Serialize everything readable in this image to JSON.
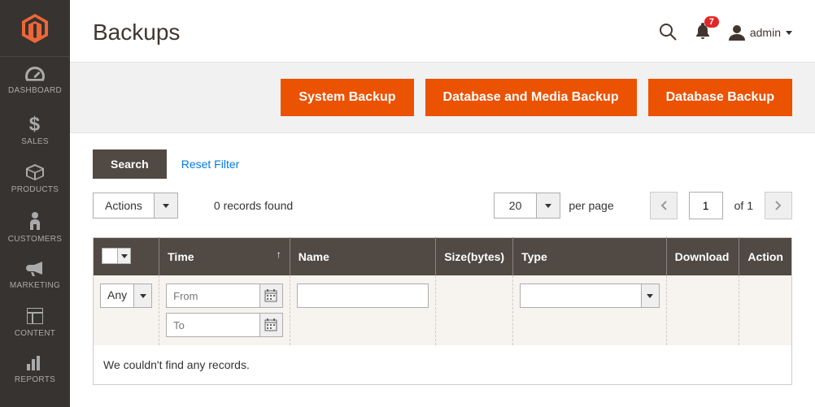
{
  "header": {
    "title": "Backups",
    "user": "admin",
    "notification_count": "7"
  },
  "sidebar": {
    "items": [
      {
        "label": "DASHBOARD"
      },
      {
        "label": "SALES"
      },
      {
        "label": "PRODUCTS"
      },
      {
        "label": "CUSTOMERS"
      },
      {
        "label": "MARKETING"
      },
      {
        "label": "CONTENT"
      },
      {
        "label": "REPORTS"
      }
    ]
  },
  "buttons": {
    "system_backup": "System Backup",
    "db_media_backup": "Database and Media Backup",
    "db_backup": "Database Backup"
  },
  "filters": {
    "search_label": "Search",
    "reset_label": "Reset Filter"
  },
  "toolbar": {
    "actions_label": "Actions",
    "records_found": "0 records found",
    "per_page_value": "20",
    "per_page_label": "per page",
    "page_value": "1",
    "page_of": "of 1"
  },
  "grid": {
    "headers": {
      "time": "Time",
      "name": "Name",
      "size": "Size(bytes)",
      "type": "Type",
      "download": "Download",
      "action": "Action"
    },
    "filter": {
      "any": "Any",
      "from_placeholder": "From",
      "to_placeholder": "To"
    },
    "empty": "We couldn't find any records."
  }
}
